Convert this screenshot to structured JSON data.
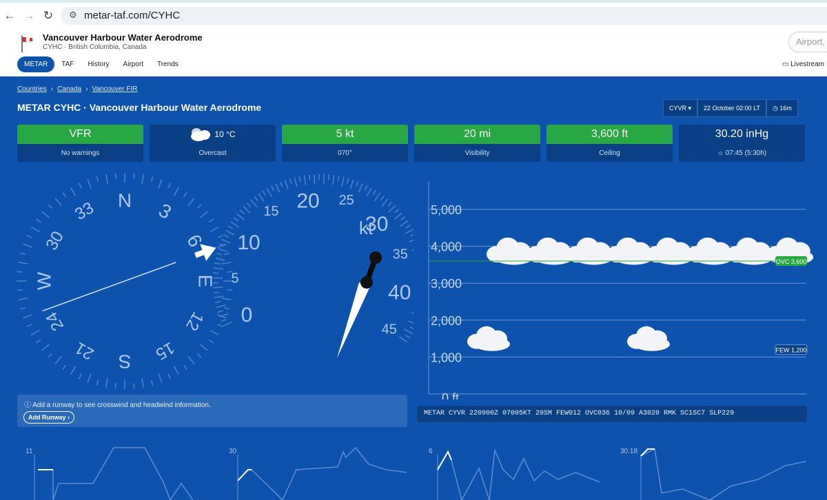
{
  "browser": {
    "url": "metar-taf.com/CYHC"
  },
  "header": {
    "title": "Vancouver Harbour Water Aerodrome",
    "subtitle": "CYHC · British Columbia, Canada",
    "search_placeholder": "Airport, c",
    "tabs": [
      "METAR",
      "TAF",
      "History",
      "Airport",
      "Trends"
    ],
    "livestream": "Livestream"
  },
  "breadcrumbs": [
    "Countries",
    "Canada",
    "Vancouver FIR"
  ],
  "page_title": "METAR CYHC · Vancouver Harbour Water Aerodrome",
  "controls": {
    "station": "CYVR",
    "datetime": "22 October 02:00 LT",
    "age": "16m"
  },
  "cards": [
    {
      "value": "VFR",
      "label": "No warnings"
    },
    {
      "value": "10 °C",
      "label": "Overcast",
      "icon": "cloud-icon"
    },
    {
      "value": "5 kt",
      "label": "070°"
    },
    {
      "value": "20 mi",
      "label": "Visibility"
    },
    {
      "value": "3,600 ft",
      "label": "Ceiling"
    },
    {
      "value": "30.20 inHg",
      "label": "07:45  (5:30h)",
      "icon": "sunrise-icon"
    }
  ],
  "compass": {
    "labels": [
      "N",
      "3",
      "6",
      "E",
      "12",
      "15",
      "S",
      "21",
      "24",
      "W",
      "30",
      "33"
    ],
    "wind_direction": 70
  },
  "wind_gauge": {
    "labels": [
      "0",
      "5",
      "10",
      "15",
      "20",
      "25",
      "30",
      "35",
      "40",
      "45"
    ],
    "unit": "kt",
    "speed": 5
  },
  "clouds": {
    "y_ticks": [
      "0 ft",
      "1,000",
      "2,000",
      "3,000",
      "4,000",
      "5,000"
    ],
    "layers": [
      {
        "label": "OVC",
        "height": "3,600",
        "value": 3600
      },
      {
        "label": "FEW",
        "height": "1,200",
        "value": 1200
      }
    ]
  },
  "crosswind": {
    "text": "Add a runway to see crosswind and headwind information.",
    "button": "Add Runway"
  },
  "metar_text": "METAR CYVR 220900Z 07005KT 20SM FEW012 OVC036 10/09 A3020 RMK SC1SC7 SLP229",
  "trends": {
    "labels": [
      "11",
      "30",
      "6",
      "30.18"
    ]
  },
  "colors": {
    "background": "#0d52ad",
    "card": "#0a3f86",
    "green": "#28a745"
  }
}
